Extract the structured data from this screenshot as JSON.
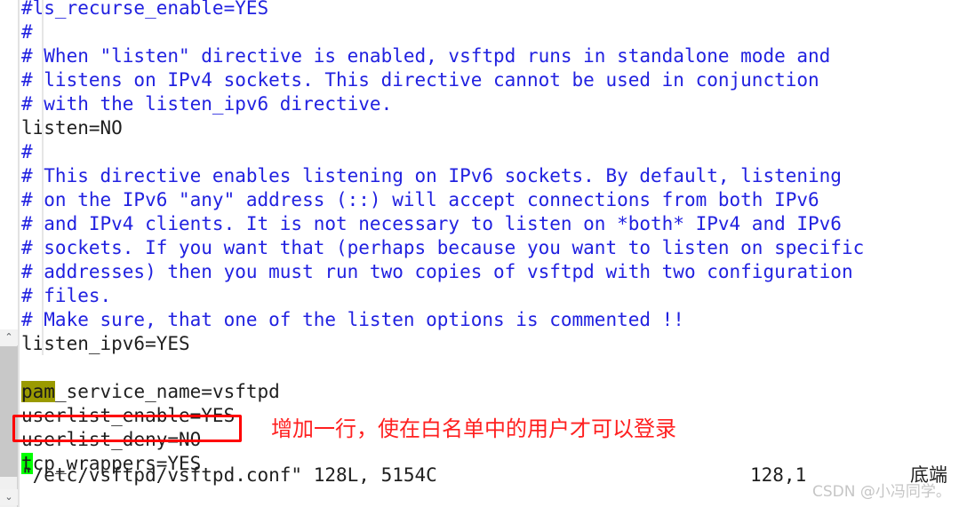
{
  "editor": {
    "app": "vim",
    "lines": [
      {
        "text": "#ls_recurse_enable=YES",
        "kind": "comment",
        "clipped_top": true
      },
      {
        "text": "#",
        "kind": "comment"
      },
      {
        "text": "# When \"listen\" directive is enabled, vsftpd runs in standalone mode and",
        "kind": "comment"
      },
      {
        "text": "# listens on IPv4 sockets. This directive cannot be used in conjunction",
        "kind": "comment"
      },
      {
        "text": "# with the listen_ipv6 directive.",
        "kind": "comment"
      },
      {
        "text": "listen=NO",
        "kind": "code"
      },
      {
        "text": "#",
        "kind": "comment"
      },
      {
        "text": "# This directive enables listening on IPv6 sockets. By default, listening",
        "kind": "comment"
      },
      {
        "text": "# on the IPv6 \"any\" address (::) will accept connections from both IPv6",
        "kind": "comment"
      },
      {
        "text": "# and IPv4 clients. It is not necessary to listen on *both* IPv4 and IPv6",
        "kind": "comment"
      },
      {
        "text": "# sockets. If you want that (perhaps because you want to listen on specific",
        "kind": "comment"
      },
      {
        "text": "# addresses) then you must run two copies of vsftpd with two configuration",
        "kind": "comment"
      },
      {
        "text": "# files.",
        "kind": "comment"
      },
      {
        "text": "# Make sure, that one of the listen options is commented !!",
        "kind": "comment"
      },
      {
        "text": "listen_ipv6=YES",
        "kind": "code"
      },
      {
        "text": "",
        "kind": "blank"
      },
      {
        "text": "pam_service_name=vsftpd",
        "kind": "code",
        "search_highlight": "pam"
      },
      {
        "text": "userlist_enable=YES",
        "kind": "code"
      },
      {
        "text": "userlist_deny=NO",
        "kind": "code",
        "boxed": true
      },
      {
        "text": "tcp_wrappers=YES",
        "kind": "code",
        "cursor_highlight": "t"
      }
    ]
  },
  "statusline": {
    "file": "\"/etc/vsftpd/vsftpd.conf\" 128L, 5154C",
    "position": "128,1",
    "position_line": "128",
    "position_col": "1",
    "scroll_state": "底端"
  },
  "annotation": {
    "text": "增加一行，使在白名单中的用户才可以登录",
    "color": "#ff2020",
    "box_target": "userlist_deny=NO",
    "box_color": "#ff0000"
  },
  "scrollbar": {
    "up_arrow": "⌃",
    "down_arrow": "⌄"
  },
  "watermark": {
    "text": "CSDN @小冯同学。"
  },
  "colors": {
    "comment": "#2121e0",
    "code": "#1f1f1f",
    "search_highlight_bg": "#9a9a00",
    "cursor_bg": "#00ff00",
    "background": "#ffffff",
    "annotation": "#ff2020",
    "watermark": "#c6c6c6"
  }
}
